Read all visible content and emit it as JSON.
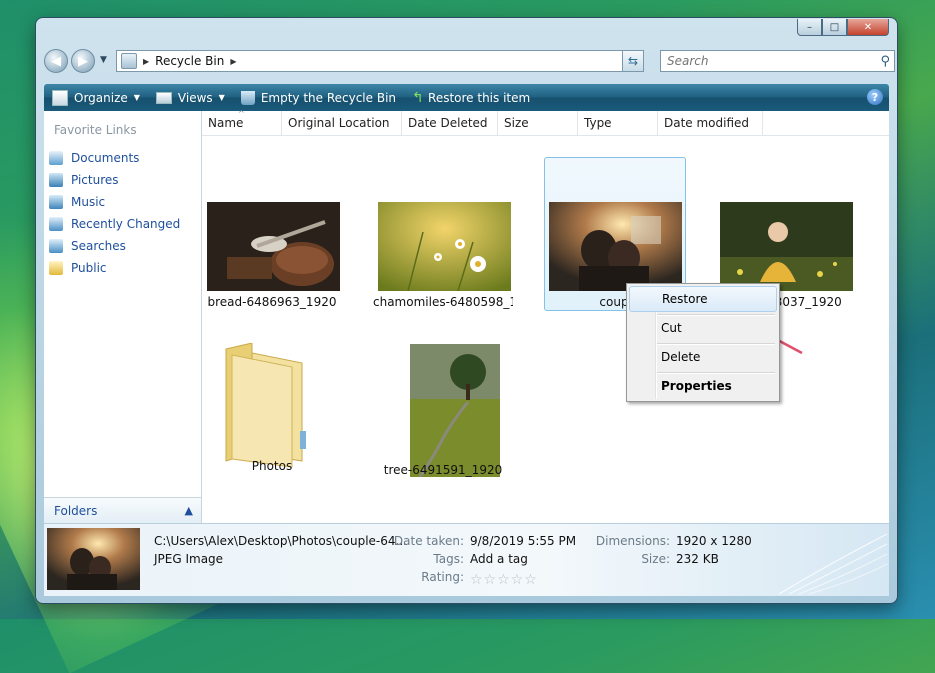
{
  "window": {
    "caption": {
      "minimize": "–",
      "maximize": "□",
      "close": "✕"
    }
  },
  "nav": {
    "back": "◀",
    "forward": "▶",
    "breadcrumb": "Recycle Bin",
    "search_placeholder": "Search"
  },
  "toolbar": {
    "organize": "Organize",
    "views": "Views",
    "empty": "Empty the Recycle Bin",
    "restore": "Restore this item",
    "help": "?"
  },
  "sidebar": {
    "title": "Favorite Links",
    "items": [
      {
        "label": "Documents",
        "icon": "documents-icon"
      },
      {
        "label": "Pictures",
        "icon": "pictures-icon"
      },
      {
        "label": "Music",
        "icon": "music-icon"
      },
      {
        "label": "Recently Changed",
        "icon": "recently-changed-icon"
      },
      {
        "label": "Searches",
        "icon": "searches-icon"
      },
      {
        "label": "Public",
        "icon": "public-icon"
      }
    ],
    "folders_label": "Folders"
  },
  "columns": [
    "Name",
    "Original Location",
    "Date Deleted",
    "Size",
    "Type",
    "Date modified"
  ],
  "items": [
    {
      "name": "bread-6486963_1920"
    },
    {
      "name": "chamomiles-6480598_1..."
    },
    {
      "name": "coup"
    },
    {
      "name": "girl-6053037_1920"
    },
    {
      "name": "Photos"
    },
    {
      "name": "tree-6491591_1920"
    }
  ],
  "context_menu": {
    "restore": "Restore",
    "cut": "Cut",
    "delete": "Delete",
    "properties": "Properties"
  },
  "details": {
    "path": "C:\\Users\\Alex\\Desktop\\Photos\\couple-64...",
    "type": "JPEG Image",
    "date_taken_label": "Date taken:",
    "date_taken": "9/8/2019 5:55 PM",
    "tags_label": "Tags:",
    "tags": "Add a tag",
    "rating_label": "Rating:",
    "rating": "☆☆☆☆☆",
    "dimensions_label": "Dimensions:",
    "dimensions": "1920 x 1280",
    "size_label": "Size:",
    "size": "232 KB"
  },
  "colors": {
    "accent": "#1e4f9c",
    "toolbar": "#1f5f80",
    "annotation_arrow": "#e0506a"
  }
}
